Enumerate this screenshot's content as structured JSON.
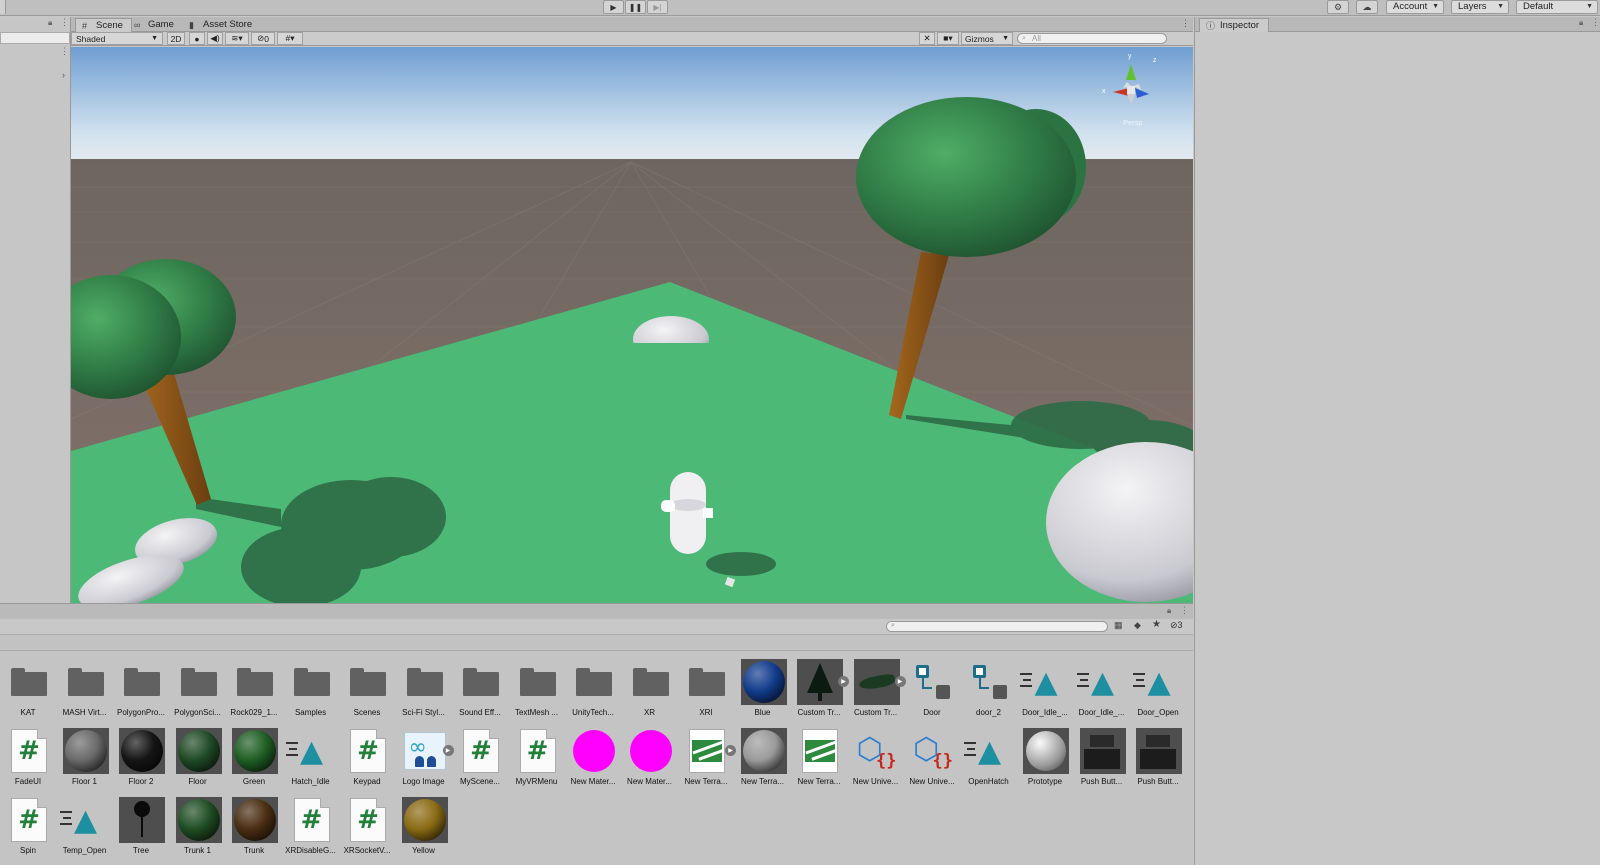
{
  "toolbar": {
    "account_label": "Account",
    "layers_label": "Layers",
    "layout_label": "Default"
  },
  "scene_tabs": [
    {
      "label": "Scene",
      "icon": "hash-grid-icon"
    },
    {
      "label": "Game",
      "icon": "gamepad-icon"
    },
    {
      "label": "Asset Store",
      "icon": "bag-icon"
    }
  ],
  "scene_bar": {
    "shading_mode": "Shaded",
    "mode_2d": "2D",
    "hidden_count": "0",
    "gizmos_label": "Gizmos",
    "search_placeholder": "All"
  },
  "viewport": {
    "gizmo_label": "Persp",
    "axis_y": "y",
    "axis_x": "x",
    "axis_z": "z"
  },
  "inspector": {
    "tab_label": "Inspector"
  },
  "project": {
    "hidden_count": "3",
    "assets_row1": [
      {
        "name": "KAT",
        "type": "folder"
      },
      {
        "name": "MASH Virt...",
        "type": "folder"
      },
      {
        "name": "PolygonPro...",
        "type": "folder"
      },
      {
        "name": "PolygonSci...",
        "type": "folder"
      },
      {
        "name": "Rock029_1...",
        "type": "folder"
      },
      {
        "name": "Samples",
        "type": "folder"
      },
      {
        "name": "Scenes",
        "type": "folder"
      },
      {
        "name": "Sci-Fi Styl...",
        "type": "folder"
      },
      {
        "name": "Sound Eff...",
        "type": "folder"
      },
      {
        "name": "TextMesh ...",
        "type": "folder"
      },
      {
        "name": "UnityTech...",
        "type": "folder"
      },
      {
        "name": "XR",
        "type": "folder"
      },
      {
        "name": "XRI",
        "type": "folder"
      },
      {
        "name": "Blue",
        "type": "material",
        "color": "#123c8c"
      },
      {
        "name": "Custom Tr...",
        "type": "tree-prefab"
      },
      {
        "name": "Custom Tr...",
        "type": "tree-prefab-flat"
      },
      {
        "name": "Door",
        "type": "animator"
      },
      {
        "name": "door_2",
        "type": "animator"
      },
      {
        "name": "Door_Idle_...",
        "type": "animation"
      },
      {
        "name": "Door_Idle_...",
        "type": "animation"
      },
      {
        "name": "Door_Open",
        "type": "animation"
      }
    ],
    "assets_row2": [
      {
        "name": "FadeUI",
        "type": "script"
      },
      {
        "name": "Floor 1",
        "type": "material",
        "color": "#6a6a6a"
      },
      {
        "name": "Floor 2",
        "type": "material",
        "color": "#151515"
      },
      {
        "name": "Floor",
        "type": "material",
        "color": "#1f4a26"
      },
      {
        "name": "Green",
        "type": "material",
        "color": "#1f5e24"
      },
      {
        "name": "Hatch_Idle",
        "type": "animation"
      },
      {
        "name": "Keypad",
        "type": "script"
      },
      {
        "name": "Logo Image",
        "type": "image"
      },
      {
        "name": "MyScene...",
        "type": "script"
      },
      {
        "name": "MyVRMenu",
        "type": "script"
      },
      {
        "name": "New Mater...",
        "type": "material-flat",
        "color": "#ff00ff"
      },
      {
        "name": "New Mater...",
        "type": "material-flat",
        "color": "#ff00ff"
      },
      {
        "name": "New Terra...",
        "type": "terrain-arrow"
      },
      {
        "name": "New Terra...",
        "type": "material",
        "color": "#9a9a9a"
      },
      {
        "name": "New Terra...",
        "type": "terrain"
      },
      {
        "name": "New Unive...",
        "type": "urp"
      },
      {
        "name": "New Unive...",
        "type": "urp"
      },
      {
        "name": "OpenHatch",
        "type": "animation"
      },
      {
        "name": "Prototype",
        "type": "prototype"
      },
      {
        "name": "Push Butt...",
        "type": "pushbutton"
      },
      {
        "name": "Push Butt...",
        "type": "pushbutton"
      }
    ],
    "assets_row3": [
      {
        "name": "Spin",
        "type": "script"
      },
      {
        "name": "Temp_Open",
        "type": "animation"
      },
      {
        "name": "Tree",
        "type": "lollipop"
      },
      {
        "name": "Trunk 1",
        "type": "material",
        "color": "#1f4d22"
      },
      {
        "name": "Trunk",
        "type": "material",
        "color": "#4a2e12"
      },
      {
        "name": "XRDisableG...",
        "type": "script"
      },
      {
        "name": "XRSocketV...",
        "type": "script"
      },
      {
        "name": "Yellow",
        "type": "material",
        "color": "#8a6a14"
      }
    ]
  }
}
